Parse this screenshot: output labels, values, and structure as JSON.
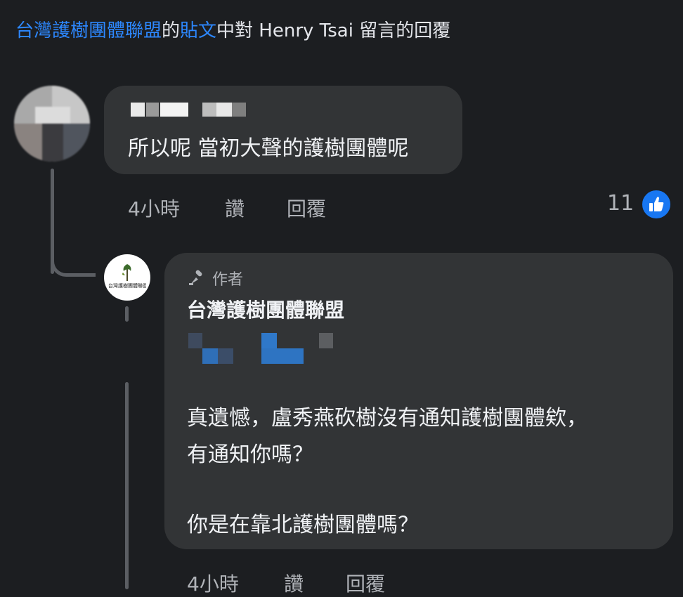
{
  "header": {
    "org_link": "台灣護樹團體聯盟",
    "of": "的",
    "post_link": "貼文",
    "rest": "中對 Henry Tsai 留言的回覆"
  },
  "comment": {
    "text": "所以呢 當初大聲的護樹團體呢",
    "time": "4小時",
    "like_label": "讚",
    "reply_label": "回覆",
    "reaction_count": "11"
  },
  "reply": {
    "badge": "作者",
    "author": "台灣護樹團體聯盟",
    "lines": [
      "真遺憾，盧秀燕砍樹沒有通知護樹團體欸，",
      "有通知你嗎？"
    ],
    "line3": "你是在靠北護樹團體嗎？",
    "time": "4小時",
    "like_label": "讚",
    "reply_label": "回覆",
    "avatar_text": "台灣護樹團體聯盟"
  },
  "colors": {
    "link": "#2d88ff",
    "bubble": "#323436",
    "background": "#1c1e21",
    "like": "#1877f2"
  }
}
